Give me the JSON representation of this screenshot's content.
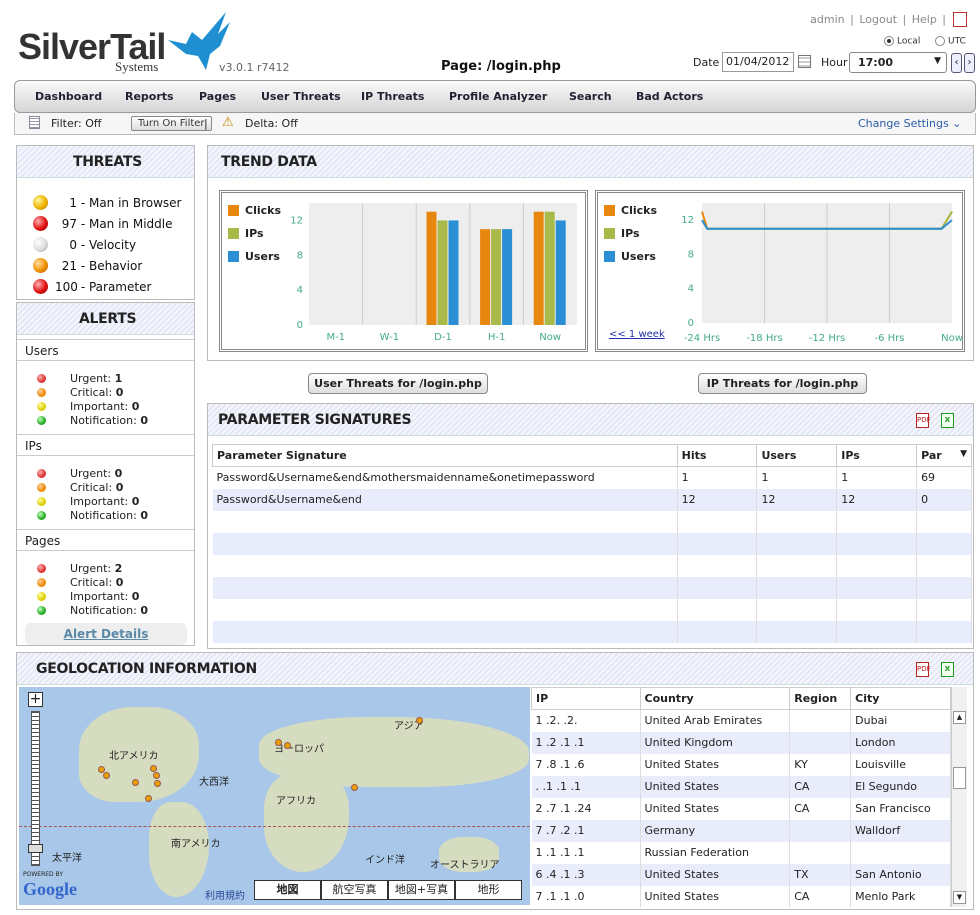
{
  "header": {
    "logo_main": "SilverTail",
    "logo_sub": "Systems",
    "version": "v3.0.1 r7412",
    "page_title": "Page: /login.php",
    "links": [
      "admin",
      "Logout",
      "Help"
    ],
    "radio_local": "Local",
    "radio_utc": "UTC",
    "date_label": "Date",
    "date_value": "01/04/2012",
    "hour_label": "Hour",
    "hour_value": "17:00"
  },
  "menu": [
    "Dashboard",
    "Reports",
    "Pages",
    "User Threats",
    "IP Threats",
    "Profile Analyzer",
    "Search",
    "Bad Actors"
  ],
  "filterbar": {
    "filter": "Filter: Off",
    "turn_on": "Turn On Filter",
    "sep": "|",
    "delta": "Delta: Off",
    "change_settings": "Change Settings"
  },
  "threats": {
    "title": "THREATS",
    "items": [
      {
        "count": "1",
        "label": "Man in Browser",
        "color": "yellow"
      },
      {
        "count": "97",
        "label": "Man in Middle",
        "color": "red"
      },
      {
        "count": "0",
        "label": "Velocity",
        "color": "white"
      },
      {
        "count": "21",
        "label": "Behavior",
        "color": "orange"
      },
      {
        "count": "100",
        "label": "Parameter",
        "color": "red"
      }
    ]
  },
  "alerts": {
    "title": "ALERTS",
    "sections": [
      {
        "name": "Users",
        "urgent": "1",
        "critical": "0",
        "important": "0",
        "notification": "0"
      },
      {
        "name": "IPs",
        "urgent": "0",
        "critical": "0",
        "important": "0",
        "notification": "0"
      },
      {
        "name": "Pages",
        "urgent": "2",
        "critical": "0",
        "important": "0",
        "notification": "0"
      }
    ],
    "labels": {
      "urgent": "Urgent:",
      "critical": "Critical:",
      "important": "Important:",
      "notification": "Notification:"
    },
    "details_link": "Alert Details"
  },
  "trend": {
    "title": "TREND DATA",
    "legend": [
      "Clicks",
      "IPs",
      "Users"
    ],
    "colors": {
      "clicks": "#e8870e",
      "ips": "#a9b94a",
      "users": "#2b8fd6"
    },
    "week_link": "<< 1 week"
  },
  "chart_data": [
    {
      "type": "bar",
      "categories": [
        "M-1",
        "W-1",
        "D-1",
        "H-1",
        "Now"
      ],
      "series": [
        {
          "name": "Clicks",
          "values": [
            0,
            0,
            13,
            11,
            13
          ]
        },
        {
          "name": "IPs",
          "values": [
            0,
            0,
            12,
            11,
            13
          ]
        },
        {
          "name": "Users",
          "values": [
            0,
            0,
            12,
            11,
            12
          ]
        }
      ],
      "yticks": [
        0,
        4,
        8,
        12
      ],
      "ylim": [
        0,
        14
      ]
    },
    {
      "type": "line",
      "x": [
        "-24 Hrs",
        "-18 Hrs",
        "-12 Hrs",
        "-6 Hrs",
        "Now"
      ],
      "series": [
        {
          "name": "Clicks",
          "points": [
            [
              -24,
              13
            ],
            [
              -23.5,
              11
            ],
            [
              -1,
              11
            ],
            [
              0,
              13
            ]
          ]
        },
        {
          "name": "IPs",
          "points": [
            [
              -24,
              12
            ],
            [
              -23.5,
              11
            ],
            [
              -1,
              11
            ],
            [
              0,
              13
            ]
          ]
        },
        {
          "name": "Users",
          "points": [
            [
              -24,
              12
            ],
            [
              -23.5,
              11
            ],
            [
              -1,
              11
            ],
            [
              0,
              12
            ]
          ]
        }
      ],
      "yticks": [
        0,
        4,
        8,
        12
      ],
      "ylim": [
        0,
        14
      ],
      "xlim": [
        -24,
        0
      ]
    }
  ],
  "buttons": {
    "user_threats": "User Threats for /login.php",
    "ip_threats": "IP Threats for /login.php"
  },
  "params": {
    "title": "PARAMETER SIGNATURES",
    "columns": [
      "Parameter Signature",
      "Hits",
      "Users",
      "IPs",
      "Par"
    ],
    "rows": [
      [
        "Password&Username&end&mothersmaidenname&onetimepassword",
        "1",
        "1",
        "1",
        "69"
      ],
      [
        "Password&Username&end",
        "12",
        "12",
        "12",
        "0"
      ]
    ]
  },
  "geo": {
    "title": "GEOLOCATION INFORMATION",
    "columns": [
      "IP",
      "Country",
      "Region",
      "City"
    ],
    "rows": [
      [
        "1 .2. .2.",
        "United Arab Emirates",
        "",
        "Dubai"
      ],
      [
        "1 .2 .1 .1",
        "United Kingdom",
        "",
        "London"
      ],
      [
        "7 .8 .1 .6",
        "United States",
        "KY",
        "Louisville"
      ],
      [
        ". .1 .1 .1",
        "United States",
        "CA",
        "El Segundo"
      ],
      [
        "2 .7 .1 .24",
        "United States",
        "CA",
        "San Francisco"
      ],
      [
        "7 .7 .2 .1",
        "Germany",
        "",
        "Walldorf"
      ],
      [
        "1 .1 .1 .1",
        "Russian Federation",
        "",
        ""
      ],
      [
        "6 .4 .1 .3",
        "United States",
        "TX",
        "San Antonio"
      ],
      [
        "7 .1 .1 .0",
        "United States",
        "CA",
        "Menlo Park"
      ]
    ],
    "map_labels": {
      "north_america": "北アメリカ",
      "europe": "ヨーロッパ",
      "asia": "アジア",
      "atlantic": "大西洋",
      "africa": "アフリカ",
      "south_america": "南アメリカ",
      "pacific": "太平洋",
      "indian": "インド洋",
      "australia": "オーストラリア",
      "terms": "利用規約",
      "powered": "POWERED BY",
      "google": "Google"
    },
    "map_types": [
      "地図",
      "航空写真",
      "地図+写真",
      "地形"
    ]
  }
}
